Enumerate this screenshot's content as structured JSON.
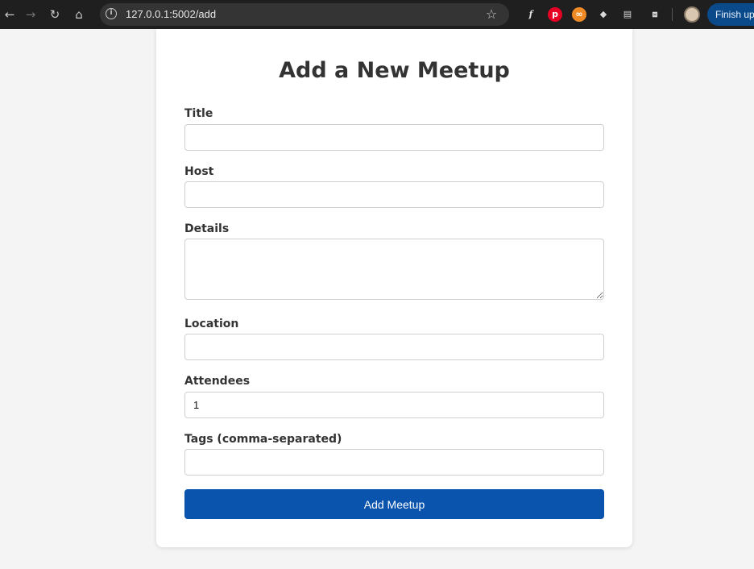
{
  "browser": {
    "url": "127.0.0.1:5002/add",
    "finish_label": "Finish up",
    "icons": [
      "back-arrow-icon",
      "forward-arrow-icon",
      "reload-icon",
      "home-icon",
      "site-info-icon",
      "bookmark-star-icon",
      "font-extension-icon",
      "pinterest-extension-icon",
      "infinity-extension-icon",
      "tag-extension-icon",
      "screen-extension-icon",
      "extensions-puzzle-icon",
      "profile-avatar"
    ]
  },
  "form": {
    "title": "Add a New Meetup",
    "fields": [
      {
        "label": "Title",
        "value": ""
      },
      {
        "label": "Host",
        "value": ""
      },
      {
        "label": "Details",
        "value": ""
      },
      {
        "label": "Location",
        "value": ""
      },
      {
        "label": "Attendees",
        "value": "1"
      },
      {
        "label": "Tags (comma-separated)",
        "value": ""
      }
    ],
    "submit_label": "Add Meetup"
  },
  "colors": {
    "primary_button": "#0a54ae",
    "finish_button": "#0b4a8a",
    "page_background": "#f4f4f4"
  }
}
